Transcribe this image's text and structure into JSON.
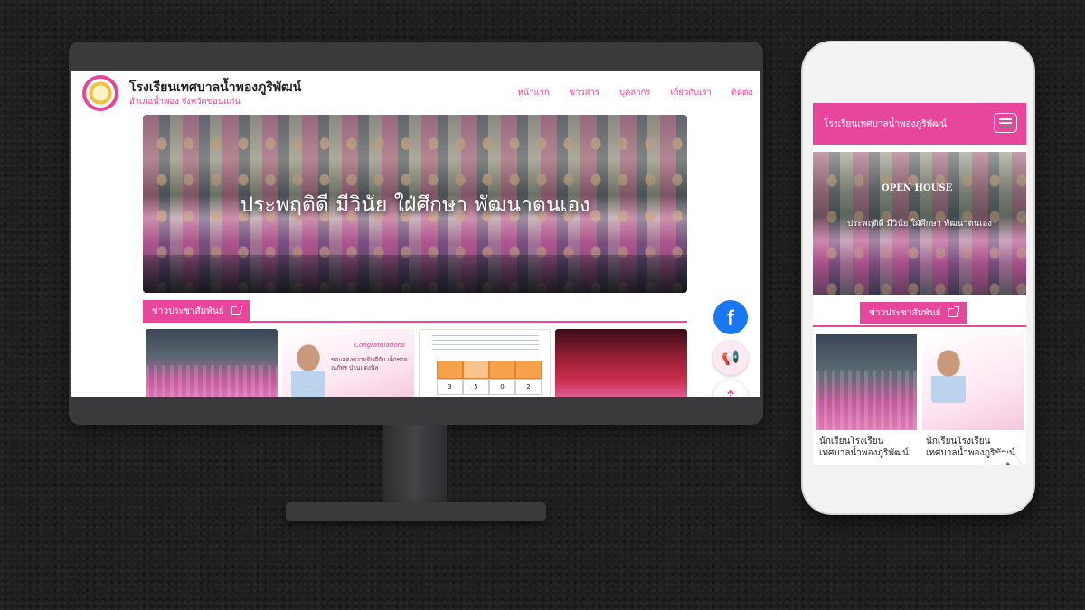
{
  "desktop": {
    "school_name": "โรงเรียนเทศบาลน้ำพองภูริพัฒน์",
    "location": "อำเภอน้ำพอง จังหวัดขอนแก่น",
    "nav": [
      "หน้าแรก",
      "ข่าวสาร",
      "บุคลากร",
      "เกี่ยวกับเรา",
      "ติดต่อ"
    ],
    "hero_text": "ประพฤติดี มีวินัย ใฝ่ศึกษา พัฒนาตนเอง",
    "section_title": "ข่าวประชาสัมพันธ์",
    "congrats_title": "Congratulations",
    "congrats_text": "ขอแสดงความยินดีกับ เด็กชายณภัทร ป่านแดงนิล",
    "table_values": [
      "3",
      "5",
      "0",
      "2"
    ],
    "facebook_glyph": "f",
    "megaphone_glyph": "📢",
    "up_glyph": "↑"
  },
  "mobile": {
    "school_name": "โรงเรียนเทศบาลน้ำพองภูริพัฒน์",
    "hero_text": "ประพฤติดี มีวินัย ใฝ่ศึกษา พัฒนาตนเอง",
    "open_house": "OPEN HOUSE",
    "section_title": "ข่าวประชาสัมพันธ์",
    "cards": [
      {
        "caption": "นักเรียนโรงเรียนเทศบาลน้ำพองภูริพัฒน์"
      },
      {
        "caption": "นักเรียนโรงเรียนเทศบาลน้ำพองภูริพัฒน์"
      }
    ],
    "megaphone_glyph": "📢"
  },
  "colors": {
    "brand_pink": "#e8469a",
    "facebook_blue": "#1877f2",
    "background": "#1f1f1f"
  }
}
